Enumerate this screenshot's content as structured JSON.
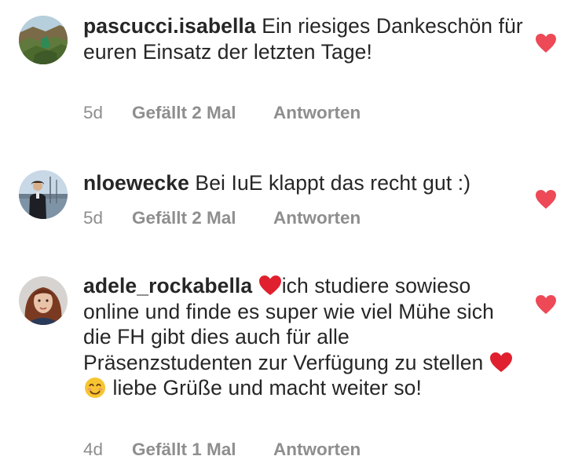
{
  "comments": [
    {
      "username": "pascucci.isabella",
      "segments": [
        "Ein riesiges Dankeschön für euren Einsatz der letzten Tage!"
      ],
      "age": "5d",
      "likes": "Gefällt 2 Mal",
      "reply": "Antworten",
      "liked": true,
      "avatar_icon": "landscape-avatar"
    },
    {
      "username": "nloewecke",
      "segments": [
        "Bei IuE klappt das recht gut :)"
      ],
      "age": "5d",
      "likes": "Gefällt 2 Mal",
      "reply": "Antworten",
      "liked": true,
      "avatar_icon": "person-avatar"
    },
    {
      "username": "adele_rockabella",
      "segments": [
        "ich studiere sowieso online und finde es super wie viel Mühe sich die FH gibt dies auch für alle Präsenzstudenten zur Verfügung zu stellen",
        "liebe Grüße und macht weiter so!"
      ],
      "emojis": [
        "red-heart-emoji",
        "red-heart-emoji",
        "smiling-face-emoji"
      ],
      "age": "4d",
      "likes": "Gefällt 1 Mal",
      "reply": "Antworten",
      "liked": true,
      "avatar_icon": "portrait-avatar"
    }
  ],
  "colors": {
    "text": "#262626",
    "meta": "#8e8e8e",
    "heart": "#ed4956"
  }
}
